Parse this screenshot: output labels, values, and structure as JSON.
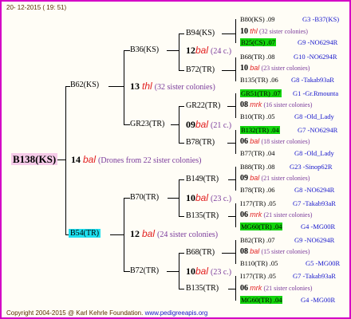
{
  "header": {
    "date": "20- 12-2015 ( 19: 51)"
  },
  "colors": {
    "border": "#d400c6",
    "root_bg": "#f6cbe9",
    "highlight_cyan": "#1ee0f0",
    "highlight_green": "#13d40c",
    "dot_red": "#e21f1f",
    "note_purple": "#7a3a9b",
    "ref_blue": "#1515cc"
  },
  "tree": {
    "root": {
      "name": "B138(KS)",
      "num": "14",
      "dot": "bal",
      "note": "(Drones from 22 sister colonies)"
    },
    "g1": [
      {
        "name": "B62(KS)",
        "num": "13",
        "dot": "thl",
        "note": "(32 sister colonies)"
      },
      {
        "name": "B54(TR)",
        "num": "12",
        "dot": "bal",
        "note": "(24 sister colonies)"
      }
    ],
    "g2": [
      {
        "name": "B36(KS)",
        "num": "12",
        "dot": "bal",
        "note": "(24 c.)"
      },
      {
        "name": "GR23(TR)",
        "num": "09",
        "dot": "bal",
        "note": "(21 c.)"
      },
      {
        "name": "B70(TR)",
        "num": "10",
        "dot": "bal",
        "note": "(23 c.)"
      },
      {
        "name": "B72(TR)",
        "num": "10",
        "dot": "bal",
        "note": "(23 c.)"
      }
    ],
    "g3": [
      {
        "name": "B94(KS)"
      },
      {
        "name": "B72(TR)"
      },
      {
        "name": "GR22(TR)"
      },
      {
        "name": "B78(TR)"
      },
      {
        "name": "B149(TR)"
      },
      {
        "name": "B135(TR)"
      },
      {
        "name": "B68(TR)"
      },
      {
        "name": "B135(TR)"
      }
    ],
    "g4": [
      {
        "sire": "B80(KS) .09",
        "sire_ref": "G3 -B37(KS)",
        "num": "10",
        "dot": "thl",
        "note": "(32 sister colonies)",
        "dam": "B25(CS) .07",
        "dam_ref": "G9 -NO6294R"
      },
      {
        "sire": "B68(TR) .08",
        "sire_ref": "G10 -NO6294R",
        "num": "10",
        "dot": "bal",
        "note": "(23 sister colonies)",
        "dam": "B135(TR) .06",
        "dam_ref": "G8 -Takab93aR"
      },
      {
        "sire": "GR51(TR) .07",
        "sire_ref": "G1 -Gr.Rmounta",
        "num": "08",
        "dot": "mrk",
        "note": "(16 sister colonies)",
        "dam": "B10(TR) .05",
        "dam_ref": "G8 -Old_Lady"
      },
      {
        "sire": "B132(TR) .04",
        "sire_ref": "G7 -NO6294R",
        "num": "06",
        "dot": "bal",
        "note": "(18 sister colonies)",
        "dam": "B77(TR) .04",
        "dam_ref": "G8 -Old_Lady"
      },
      {
        "sire": "B88(TR) .08",
        "sire_ref": "G23 -Sinop62R",
        "num": "09",
        "dot": "bal",
        "note": "(21 sister colonies)",
        "dam": "B78(TR) .06",
        "dam_ref": "G8 -NO6294R"
      },
      {
        "sire": "I177(TR) .05",
        "sire_ref": "G7 -Takab93aR",
        "num": "06",
        "dot": "mrk",
        "note": "(21 sister colonies)",
        "dam": "MG60(TR) .04",
        "dam_ref": "G4 -MG00R"
      },
      {
        "sire": "B82(TR) .07",
        "sire_ref": "G9 -NO6294R",
        "num": "08",
        "dot": "bal",
        "note": "(15 sister colonies)",
        "dam": "B110(TR) .05",
        "dam_ref": "G5 -MG00R"
      },
      {
        "sire": "I177(TR) .05",
        "sire_ref": "G7 -Takab93aR",
        "num": "06",
        "dot": "mrk",
        "note": "(21 sister colonies)",
        "dam": "MG60(TR) .04",
        "dam_ref": "G4 -MG00R"
      }
    ]
  },
  "footer": {
    "copyright": "Copyright 2004-2015 @ Karl Kehrle Foundation.",
    "url": "www.pedigreeapis.org"
  }
}
